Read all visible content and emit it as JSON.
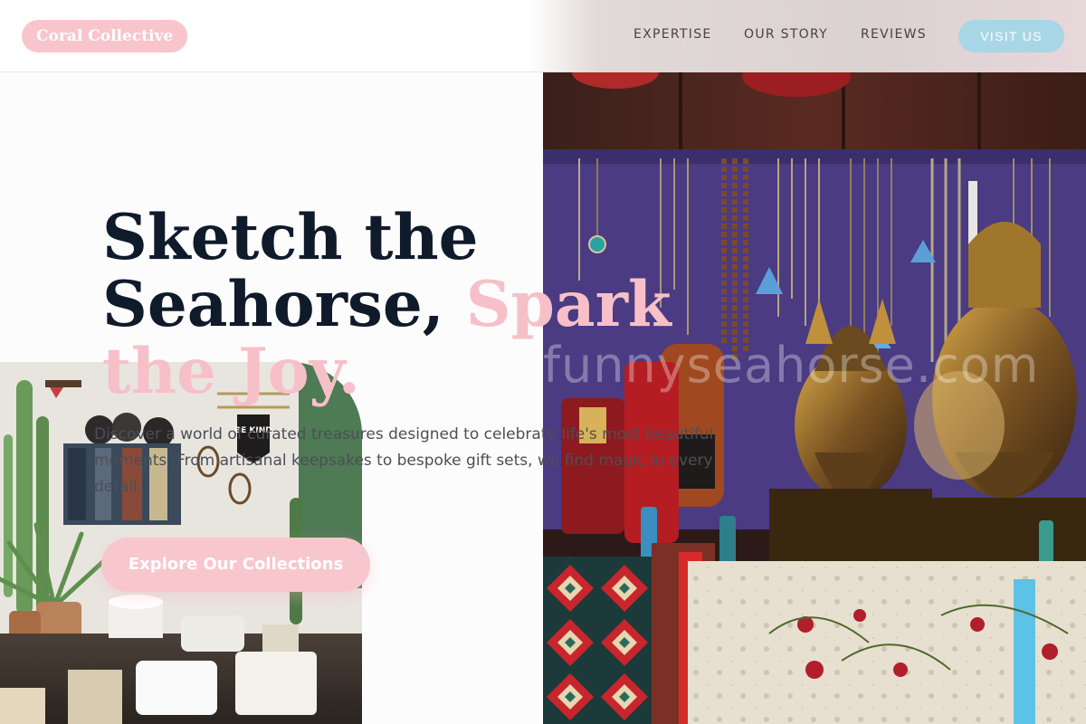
{
  "header": {
    "brand": "Coral Collective",
    "nav": [
      {
        "label": "EXPERTISE"
      },
      {
        "label": "OUR STORY"
      },
      {
        "label": "REVIEWS"
      }
    ],
    "cta_label": "VISIT US"
  },
  "hero": {
    "title_line1": "Sketch the",
    "title_line2": "Seahorse,",
    "title_accent": "Spark the Joy.",
    "subtitle": "Discover a world of curated treasures designed to celebrate life's most beautiful moments. From artisanal keepsakes to bespoke gift sets, we find magic in every detail.",
    "cta_label": "Explore Our Collections"
  },
  "images": {
    "market_watermark": "funnyseahorse.com",
    "shop_sign": "BE KIND"
  },
  "colors": {
    "accent_pink": "#f8c5cc",
    "accent_blue": "#a9d6e7",
    "title_navy": "#0f1a2b"
  }
}
